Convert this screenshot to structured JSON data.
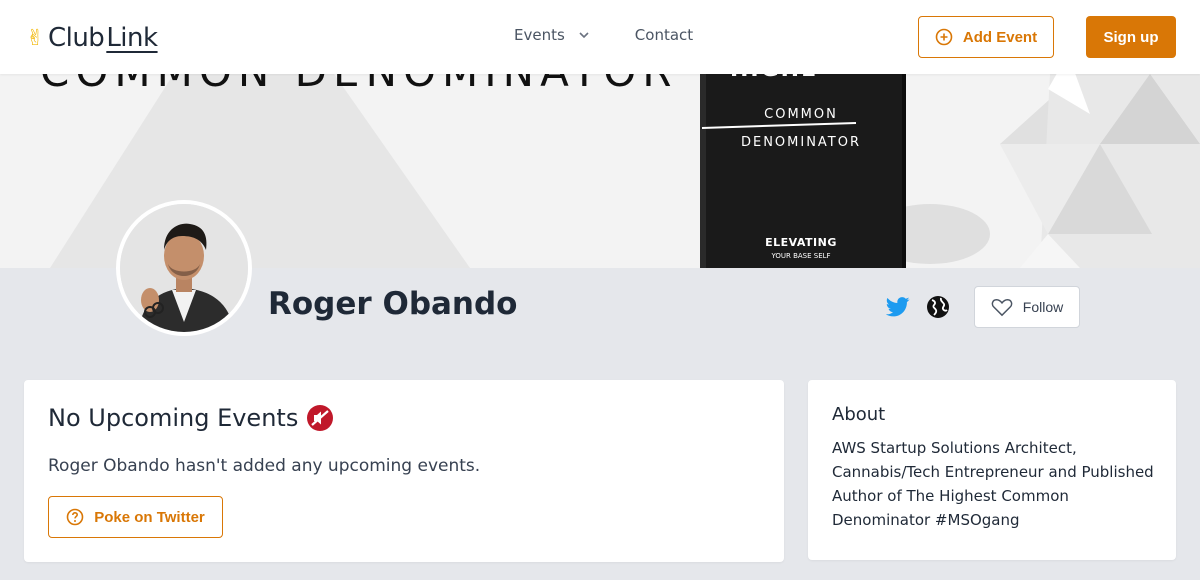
{
  "header": {
    "logo": {
      "prefix": "Club",
      "suffix": "Link",
      "icon": "victory-hand-icon"
    },
    "nav": {
      "events_label": "Events",
      "contact_label": "Contact"
    },
    "add_event_label": "Add Event",
    "signup_label": "Sign up"
  },
  "banner": {
    "text_partial": "COMMON DENOMINATOR",
    "book": {
      "title_partial": "HIGHE",
      "line1": "COMMON",
      "line2": "DENOMINATOR",
      "subtitle_main": "ELEVATING",
      "subtitle_small": "YOUR BASE SELF"
    }
  },
  "profile": {
    "name": "Roger Obando",
    "follow_label": "Follow",
    "social_icons": [
      "twitter-icon",
      "globe-icon"
    ]
  },
  "events_card": {
    "title": "No Upcoming Events",
    "title_icon": "muted-speaker-icon",
    "message": "Roger Obando hasn't added any upcoming events.",
    "poke_label": "Poke on Twitter"
  },
  "about_card": {
    "title": "About",
    "text": "AWS Startup Solutions Architect, Cannabis/Tech Entrepreneur and Published Author of The Highest Common Denominator #MSOgang"
  },
  "colors": {
    "accent": "#d97706",
    "twitter": "#1d9bf0",
    "page_bg": "#e5e7eb"
  }
}
